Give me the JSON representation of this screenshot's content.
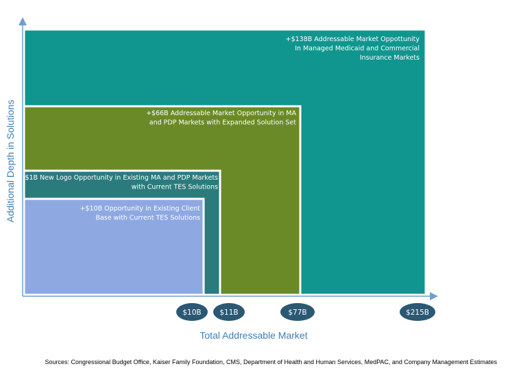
{
  "chart_data": {
    "type": "nested-area",
    "xlabel": "Total Addressable Market",
    "ylabel": "Additional Depth in Solutions",
    "segments": [
      {
        "value_label": "$215B",
        "value": 215,
        "color": "#10958f",
        "text": [
          "+$138B Addressable Market Oppottunity",
          "In Managed Medicaid and Commercial",
          "Insurance Markets"
        ]
      },
      {
        "value_label": "$77B",
        "value": 77,
        "color": "#6a8a27",
        "text": [
          "+$66B Addressable Market Opportunity in MA",
          "and PDP Markets with Expanded Solution Set"
        ]
      },
      {
        "value_label": "$11B",
        "value": 11,
        "color": "#2b7b7d",
        "text": [
          "+$1B New Logo Opportunity in Existing MA and PDP Markets",
          "with Current TES Solutions"
        ]
      },
      {
        "value_label": "$10B",
        "value": 10,
        "color": "#8ea8e2",
        "text": [
          "+$10B Opportunity in Existing Client",
          "Base with Current TES Solutions"
        ]
      }
    ],
    "axis_color": "#6f9fd0",
    "tick_color": "#2b5873"
  },
  "footer": {
    "source": "Sources: Congressional Budget Office, Kaiser Family Foundation, CMS, Department of Health and Human Services, MedPAC, and Company Management Estimates"
  }
}
